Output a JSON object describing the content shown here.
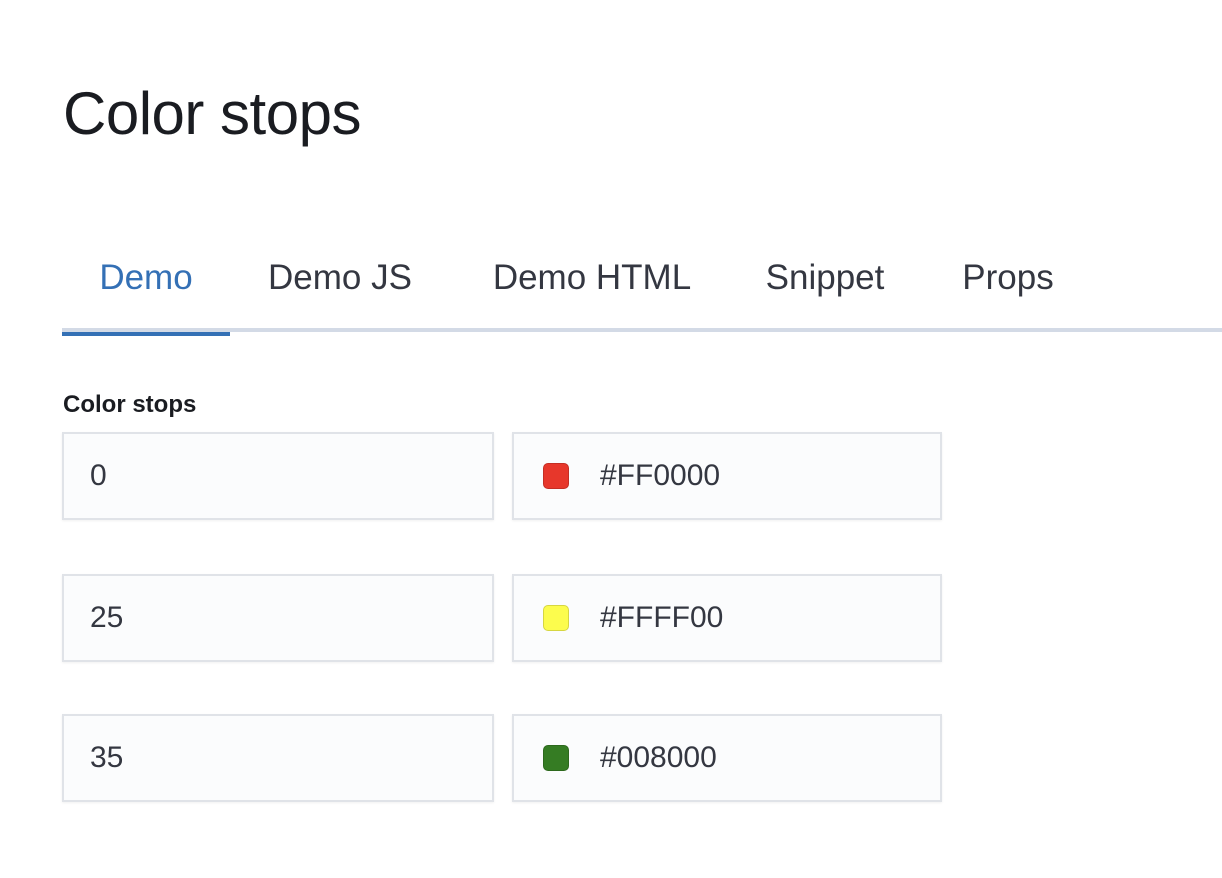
{
  "page": {
    "title": "Color stops"
  },
  "tabs": [
    {
      "label": "Demo",
      "selected": true
    },
    {
      "label": "Demo JS",
      "selected": false
    },
    {
      "label": "Demo HTML",
      "selected": false
    },
    {
      "label": "Snippet",
      "selected": false
    },
    {
      "label": "Props",
      "selected": false
    }
  ],
  "form": {
    "label": "Color stops",
    "stops": [
      {
        "stop": "0",
        "color": "#FF0000",
        "swatch": "#e7372b"
      },
      {
        "stop": "25",
        "color": "#FFFF00",
        "swatch": "#fcfc4d"
      },
      {
        "stop": "35",
        "color": "#008000",
        "swatch": "#357c23"
      }
    ]
  },
  "colors": {
    "accent": "#3470b5",
    "tab_border": "#d3dae6",
    "field_background": "#fbfcfd"
  }
}
